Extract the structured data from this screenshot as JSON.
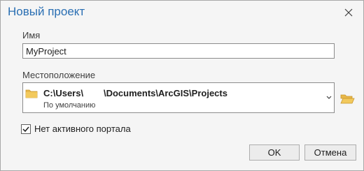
{
  "dialog": {
    "title": "Новый проект",
    "close_icon": "close-icon"
  },
  "name_field": {
    "label": "Имя",
    "value": "MyProject"
  },
  "location": {
    "label": "Местоположение",
    "path": "C:\\Users\\        \\Documents\\ArcGIS\\Projects",
    "subtitle": "По умолчанию",
    "folder_icon": "folder-icon",
    "dropdown_icon": "chevron-down-icon",
    "browse_icon": "folder-open-icon"
  },
  "checkbox": {
    "label": "Нет активного портала",
    "checked": true
  },
  "buttons": {
    "ok": "OK",
    "cancel": "Отмена"
  },
  "colors": {
    "title": "#2a6fb3",
    "folder": "#e8b84a",
    "background": "#f5f5f5"
  }
}
